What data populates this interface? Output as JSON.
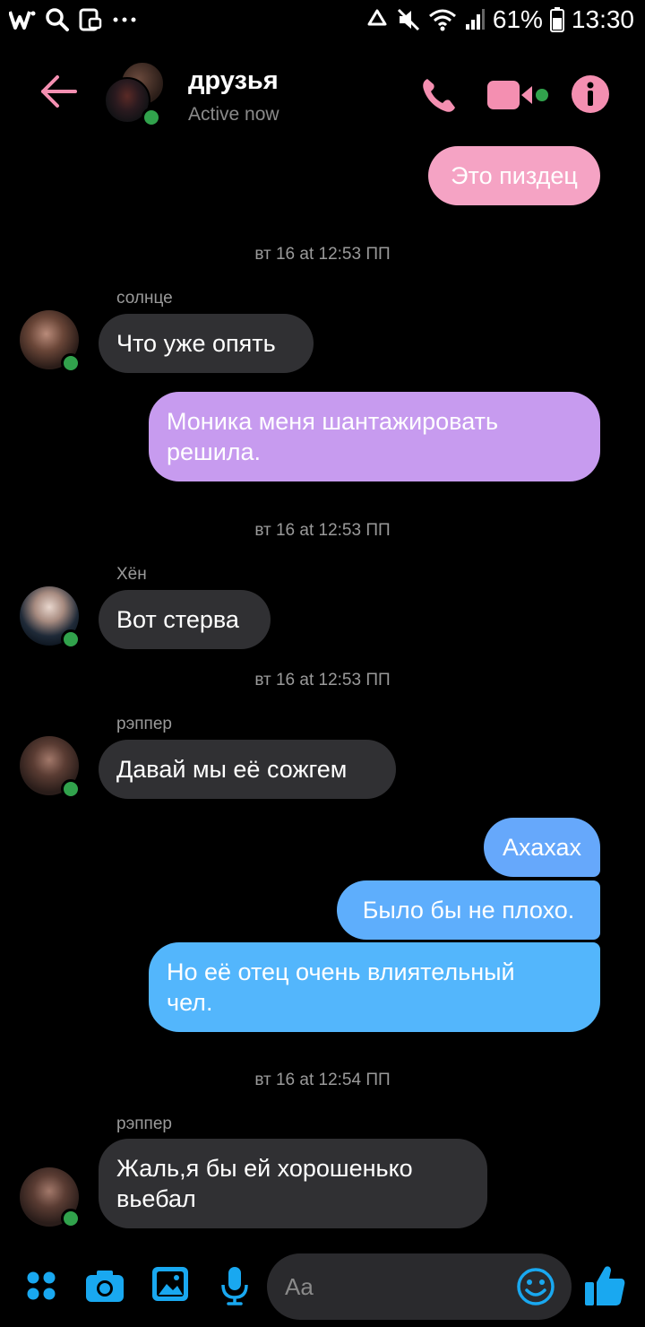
{
  "status_bar": {
    "battery": "61%",
    "time": "13:30",
    "icons": [
      "w-app-icon",
      "search-icon",
      "screenshot-icon",
      "more-dots-icon",
      "recycle-icon",
      "mute-icon",
      "wifi-icon",
      "signal-icon",
      "battery-icon"
    ]
  },
  "header": {
    "title": "друзья",
    "subtitle": "Active now",
    "accent": "#f48fb1"
  },
  "messages": {
    "m1": "Это пиздец",
    "ts1": "вт 16 at 12:53 ПП",
    "sender1": "солнце",
    "m2": "Что уже опять",
    "m3_l1": "Моника меня шантажировать",
    "m3_l2": "решила.",
    "ts2": "вт 16 at 12:53 ПП",
    "sender2": "Хён",
    "m4": "Вот стерва",
    "ts3": "вт 16 at 12:53 ПП",
    "sender3": "рэппер",
    "m5": "Давай мы её сожгем",
    "m6": "Ахахах",
    "m7": "Было бы не плохо.",
    "m8_l1": "Но её отец очень влиятельный",
    "m8_l2": "чел.",
    "ts4": "вт 16 at 12:54 ПП",
    "sender4": "рэппер",
    "m9_l1": "Жаль,я бы ей хорошенько",
    "m9_l2": "вьебал"
  },
  "composer": {
    "placeholder": "Aa",
    "accent": "#19a8f0"
  }
}
